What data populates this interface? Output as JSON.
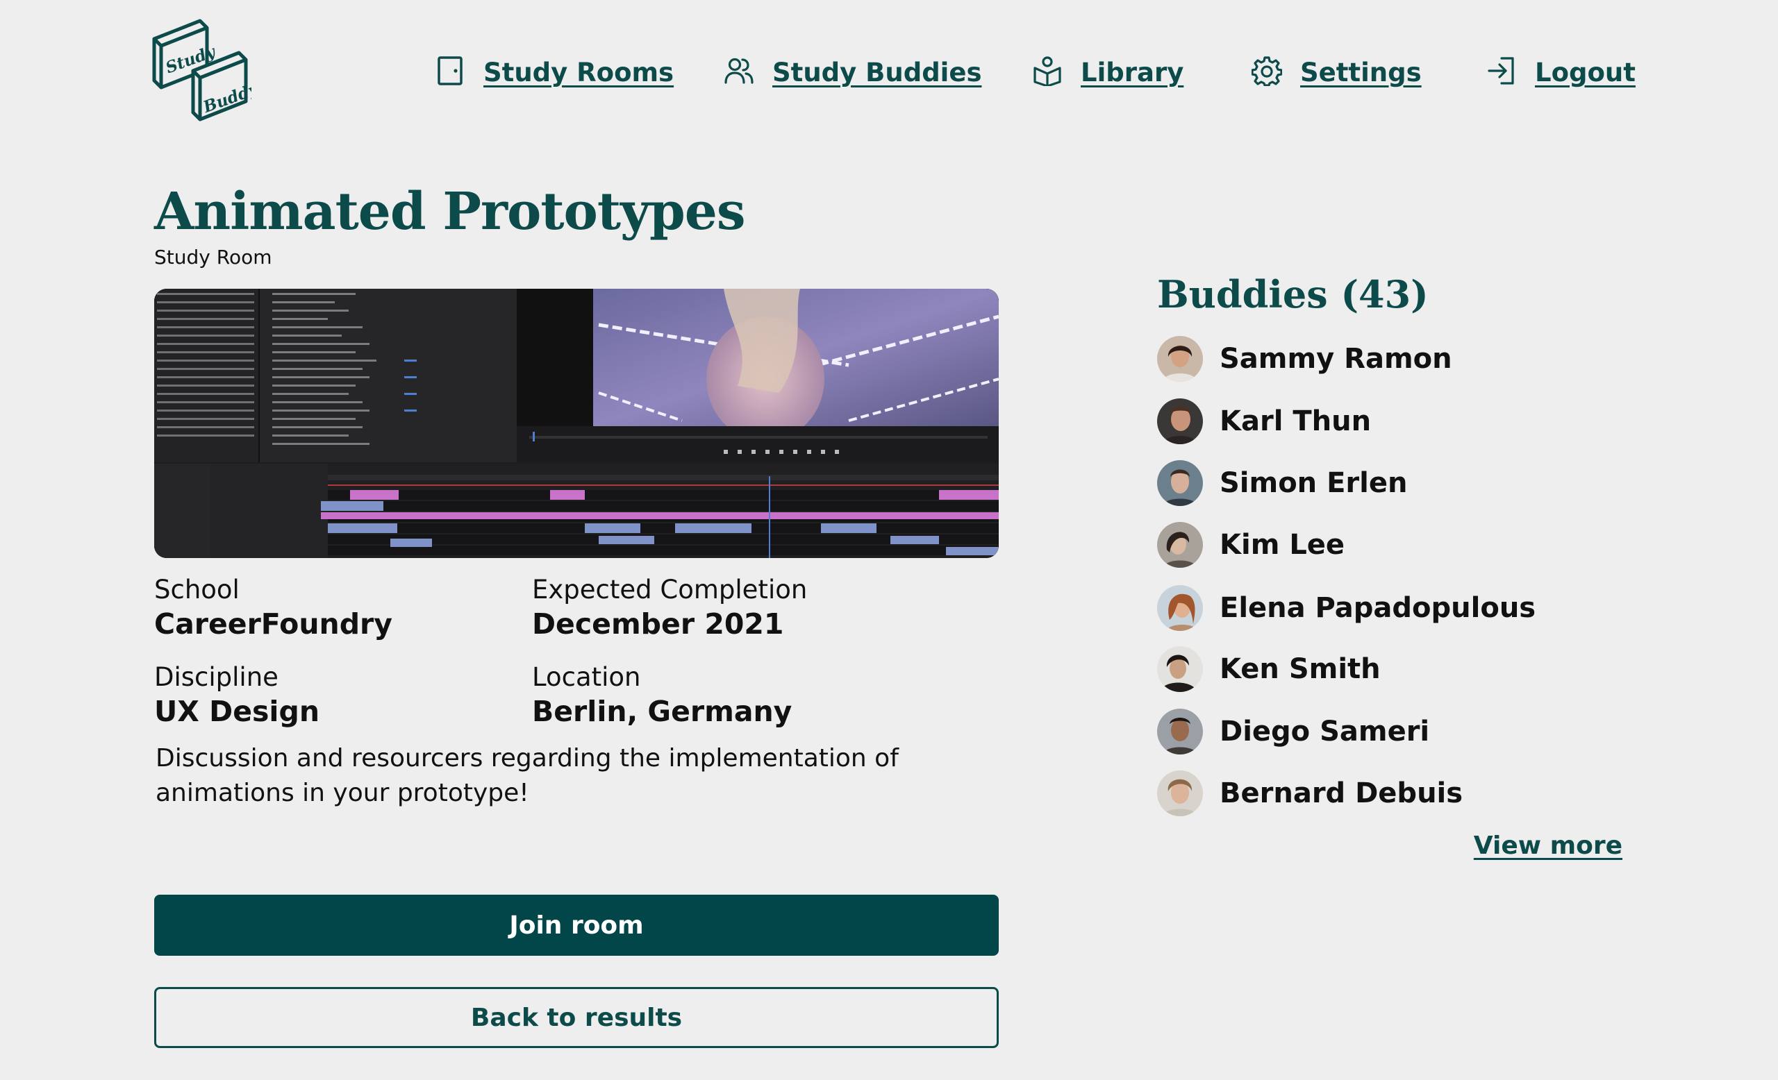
{
  "brand": {
    "logo_line1": "Study",
    "logo_line2": "Buddy",
    "color": "#0d4a4a"
  },
  "nav": {
    "items": [
      {
        "label": "Study Rooms",
        "icon": "door-icon"
      },
      {
        "label": "Study Buddies",
        "icon": "users-icon"
      },
      {
        "label": "Library",
        "icon": "reading-icon"
      },
      {
        "label": "Settings",
        "icon": "gear-icon"
      },
      {
        "label": "Logout",
        "icon": "logout-icon"
      }
    ]
  },
  "room": {
    "title": "Animated Prototypes",
    "subtitle": "Study Room",
    "image": "video-editor-screenshot",
    "school_label": "School",
    "school": "CareerFoundry",
    "completion_label": "Expected Completion",
    "completion": "December 2021",
    "discipline_label": "Discipline",
    "discipline": "UX Design",
    "location_label": "Location",
    "location": "Berlin, Germany",
    "description": "Discussion and resourcers regarding the implementation of animations in your prototype!"
  },
  "actions": {
    "join_label": "Join room",
    "back_label": "Back to results",
    "primary_color": "#03464a"
  },
  "buddies": {
    "title": "Buddies (43)",
    "items": [
      {
        "name": "Sammy Ramon"
      },
      {
        "name": "Karl Thun"
      },
      {
        "name": "Simon Erlen"
      },
      {
        "name": "Kim Lee"
      },
      {
        "name": "Elena Papadopulous"
      },
      {
        "name": "Ken Smith"
      },
      {
        "name": "Diego Sameri"
      },
      {
        "name": "Bernard Debuis"
      }
    ],
    "view_more_label": "View more"
  }
}
